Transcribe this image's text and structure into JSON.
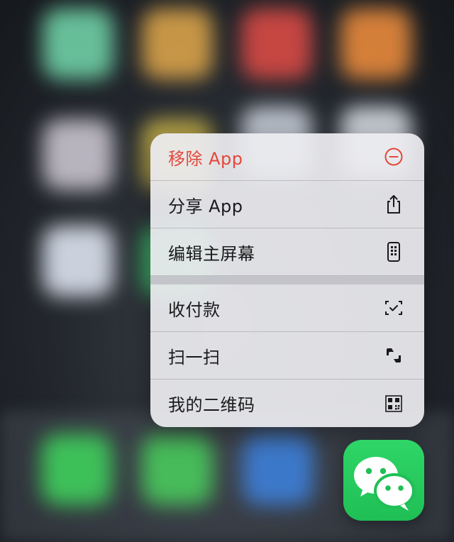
{
  "menu": {
    "items": [
      {
        "label": "移除 App",
        "icon": "minus-circle-icon",
        "style": "destructive"
      },
      {
        "label": "分享 App",
        "icon": "share-icon",
        "style": "normal"
      },
      {
        "label": "编辑主屏幕",
        "icon": "phone-edit-icon",
        "style": "normal"
      },
      {
        "label": "收付款",
        "icon": "scan-check-icon",
        "style": "normal"
      },
      {
        "label": "扫一扫",
        "icon": "scan-icon",
        "style": "normal"
      },
      {
        "label": "我的二维码",
        "icon": "qr-code-icon",
        "style": "normal"
      }
    ]
  },
  "app": {
    "name_icon": "wechat-icon"
  },
  "colors": {
    "destructive": "#e5473c",
    "wechat_green": "#28d061"
  }
}
